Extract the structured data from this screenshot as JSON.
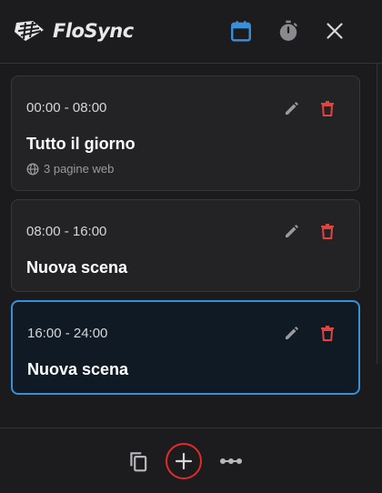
{
  "app": {
    "name": "FloSync"
  },
  "header": {
    "calendar_icon": "calendar-icon",
    "timer_icon": "timer-icon",
    "close_icon": "close-icon",
    "accent_color": "#3a8fd9"
  },
  "scenes": [
    {
      "time": "00:00 - 08:00",
      "title": "Tutto il giorno",
      "meta": "3 pagine web",
      "active": false
    },
    {
      "time": "08:00 - 16:00",
      "title": "Nuova scena",
      "active": false
    },
    {
      "time": "16:00 - 24:00",
      "title": "Nuova scena",
      "active": true
    }
  ],
  "colors": {
    "delete": "#e0443e",
    "edit": "#9a9a9e",
    "highlight_ring": "#e02b2b"
  },
  "footer": {
    "duplicate_icon": "copy-icon",
    "add_icon": "plus-icon",
    "more_icon": "more-horizontal-icon"
  }
}
